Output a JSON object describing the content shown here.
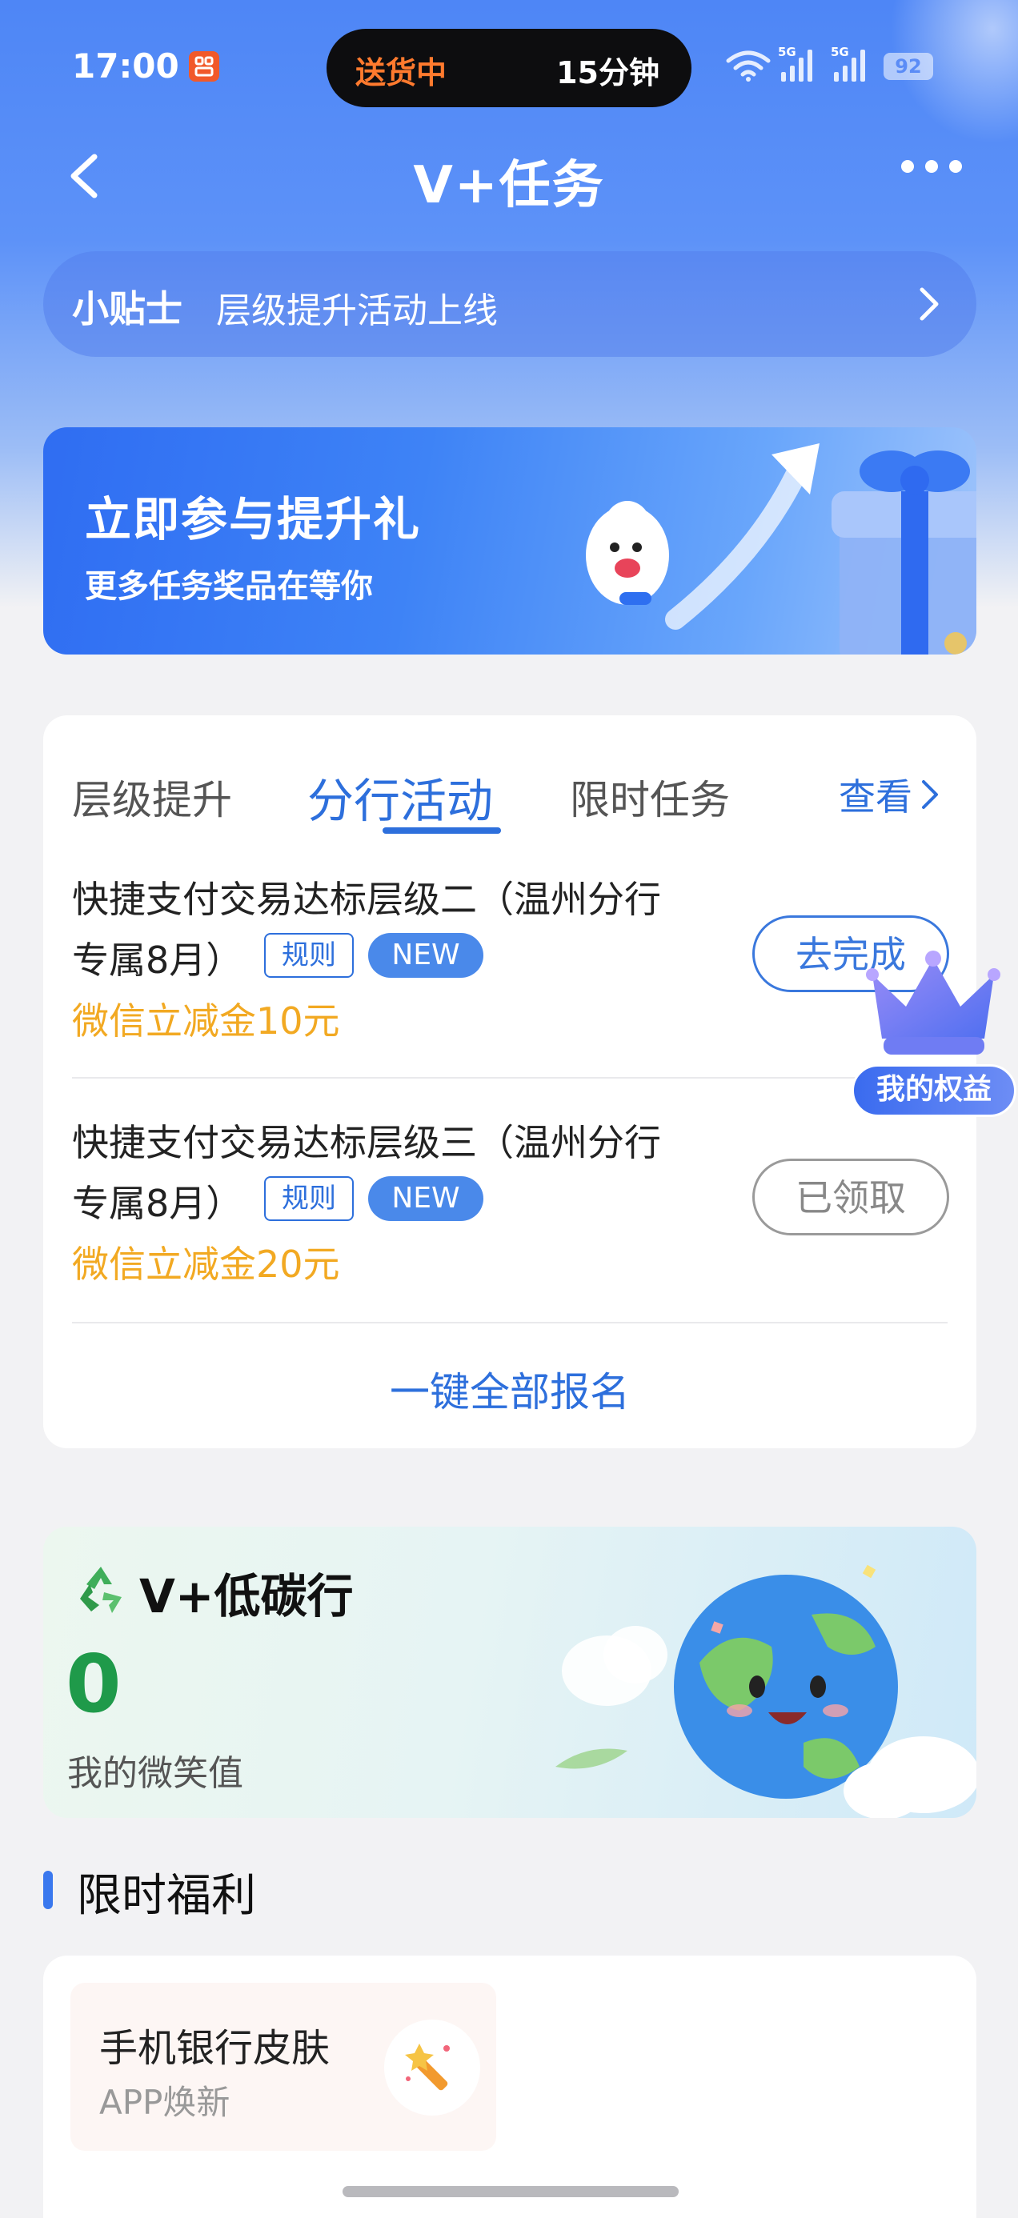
{
  "status_bar": {
    "time": "17:00",
    "app_badge": "꿈",
    "island_left": "送货中",
    "island_right": "15分钟",
    "signal1_label": "5G",
    "signal2_label": "5G",
    "battery": "92"
  },
  "nav": {
    "title": "V+任务"
  },
  "tips": {
    "tag": "小贴士",
    "text": "层级提升活动上线"
  },
  "promo": {
    "title": "立即参与提升礼",
    "subtitle": "更多任务奖品在等你"
  },
  "task_card": {
    "tabs": [
      {
        "label": "层级提升"
      },
      {
        "label": "分行活动"
      },
      {
        "label": "限时任务"
      }
    ],
    "active_tab": 1,
    "see_more": "查看",
    "tasks": [
      {
        "title_line1": "快捷支付交易达标层级二（温州分行",
        "title_line2": "专属8月）",
        "rule_label": "规则",
        "new_label": "NEW",
        "reward": "微信立减金10元",
        "button": "去完成"
      },
      {
        "title_line1": "快捷支付交易达标层级三（温州分行",
        "title_line2": "专属8月）",
        "rule_label": "规则",
        "new_label": "NEW",
        "reward": "微信立减金20元",
        "button": "已领取"
      }
    ],
    "enroll_all": "一键全部报名"
  },
  "rights": {
    "label": "我的权益"
  },
  "carbon": {
    "title": "V+低碳行",
    "value": "0",
    "label": "我的微笑值"
  },
  "welfare": {
    "section_title": "限时福利",
    "items": [
      {
        "title": "手机银行皮肤",
        "subtitle": "APP焕新"
      }
    ]
  },
  "colors": {
    "primary": "#2d6fdc",
    "reward": "#f2a922",
    "carbon_green": "#1f9a4a"
  }
}
